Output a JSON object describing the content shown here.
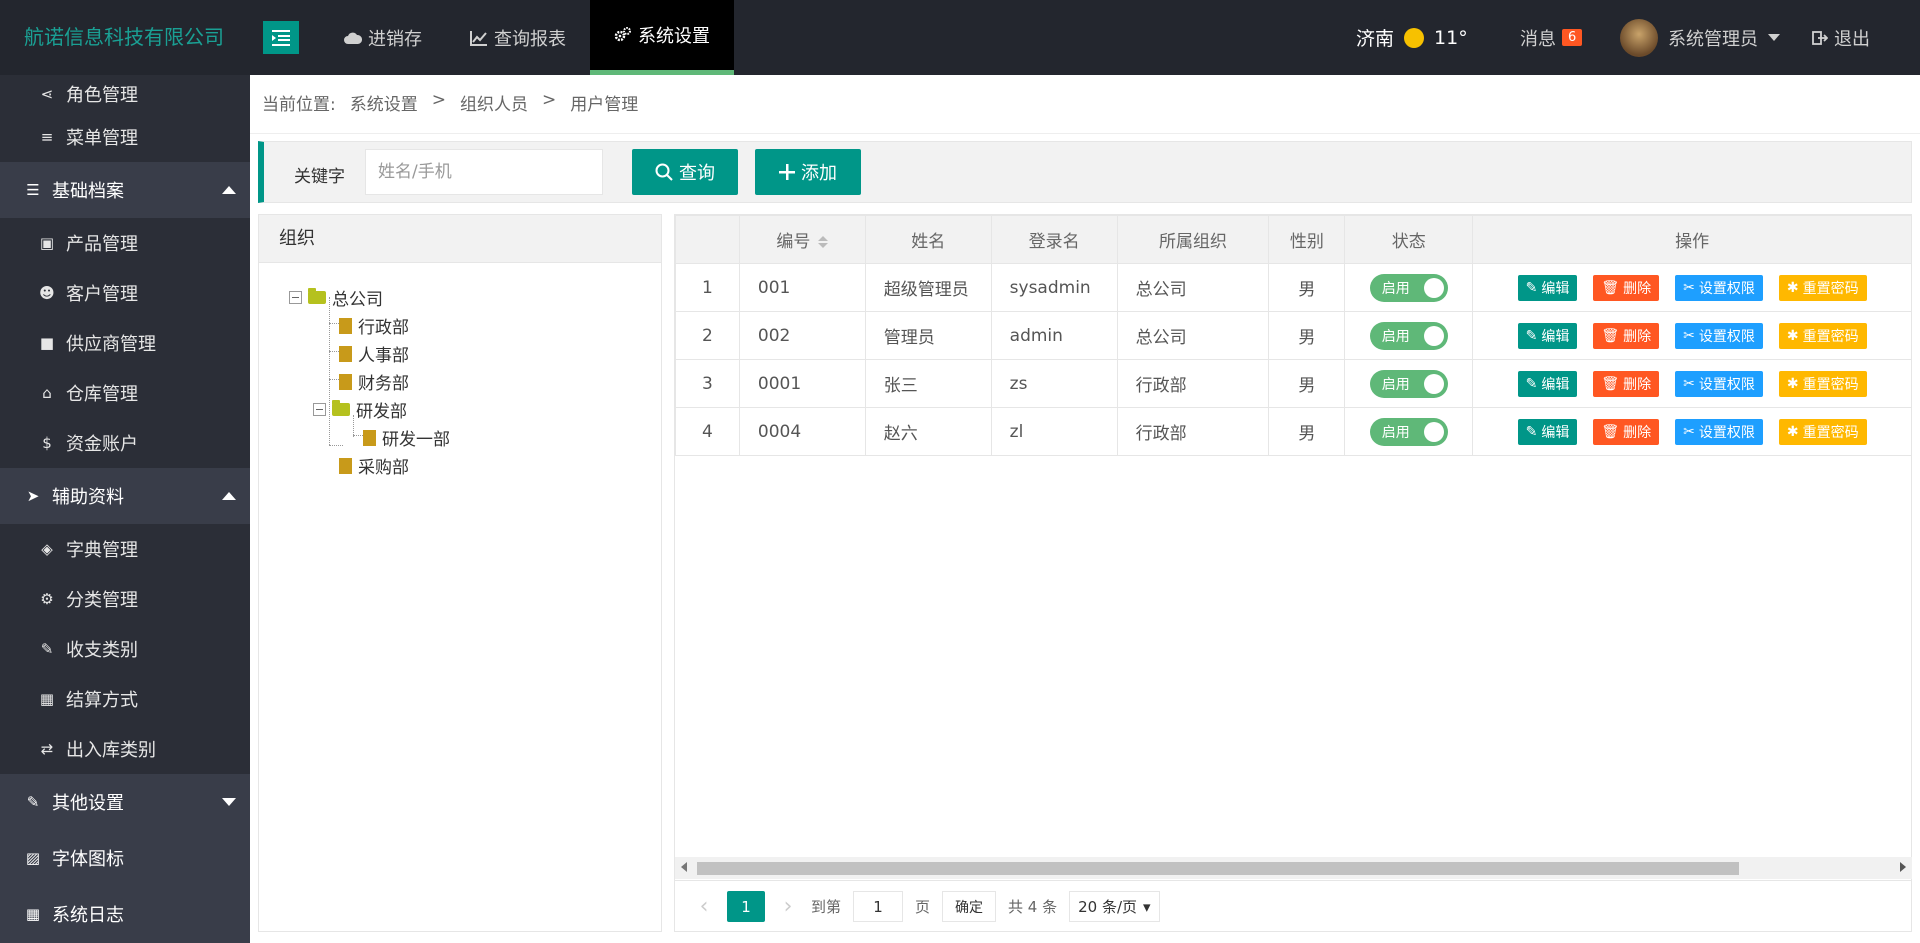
{
  "topbar": {
    "brand": "航诺信息科技有限公司",
    "nav": [
      {
        "label": "进销存",
        "icon": "cloud-icon"
      },
      {
        "label": "查询报表",
        "icon": "line-chart-icon"
      },
      {
        "label": "系统设置",
        "icon": "gears-icon"
      }
    ],
    "weather_city": "济南",
    "weather_temp": "11°",
    "messages_label": "消息",
    "messages_count": "6",
    "user_name": "系统管理员",
    "logout_label": "退出"
  },
  "sidebar": {
    "items": [
      {
        "label": "角色管理",
        "icon": "share-icon",
        "type": "sub"
      },
      {
        "label": "菜单管理",
        "icon": "bars-icon",
        "type": "sub"
      },
      {
        "label": "基础档案",
        "icon": "list-icon",
        "type": "head",
        "expanded": true
      },
      {
        "label": "产品管理",
        "icon": "shopping-bag-icon",
        "type": "sub"
      },
      {
        "label": "客户管理",
        "icon": "user-plus-icon",
        "type": "sub"
      },
      {
        "label": "供应商管理",
        "icon": "truck-icon",
        "type": "sub"
      },
      {
        "label": "仓库管理",
        "icon": "home-icon",
        "type": "sub"
      },
      {
        "label": "资金账户",
        "icon": "dollar-circle-icon",
        "type": "sub"
      },
      {
        "label": "辅助资料",
        "icon": "paper-plane-icon",
        "type": "head",
        "expanded": true
      },
      {
        "label": "字典管理",
        "icon": "layers-icon",
        "type": "sub"
      },
      {
        "label": "分类管理",
        "icon": "gears-icon",
        "type": "sub"
      },
      {
        "label": "收支类别",
        "icon": "edit-square-icon",
        "type": "sub"
      },
      {
        "label": "结算方式",
        "icon": "calculator-icon",
        "type": "sub"
      },
      {
        "label": "出入库类别",
        "icon": "exchange-icon",
        "type": "sub"
      },
      {
        "label": "其他设置",
        "icon": "edit-icon",
        "type": "head",
        "expanded": false
      },
      {
        "label": "字体图标",
        "icon": "image-icon",
        "type": "head"
      },
      {
        "label": "系统日志",
        "icon": "table-icon",
        "type": "head"
      }
    ]
  },
  "breadcrumb": {
    "prefix": "当前位置:",
    "items": [
      "系统设置",
      "组织人员",
      "用户管理"
    ],
    "sep": ">"
  },
  "search": {
    "label": "关键字",
    "placeholder": "姓名/手机",
    "query_label": "查询",
    "add_label": "添加"
  },
  "org": {
    "title": "组织",
    "tree": {
      "root": "总公司",
      "children": [
        "行政部",
        "人事部",
        "财务部",
        "研发部",
        "采购部"
      ],
      "rd_children": [
        "研发一部"
      ]
    }
  },
  "table": {
    "columns": [
      "",
      "编号",
      "姓名",
      "登录名",
      "所属组织",
      "性别",
      "状态",
      "操作"
    ],
    "rows": [
      {
        "idx": "1",
        "code": "001",
        "name": "超级管理员",
        "login": "sysadmin",
        "org": "总公司",
        "gender": "男",
        "status": "启用"
      },
      {
        "idx": "2",
        "code": "002",
        "name": "管理员",
        "login": "admin",
        "org": "总公司",
        "gender": "男",
        "status": "启用"
      },
      {
        "idx": "3",
        "code": "0001",
        "name": "张三",
        "login": "zs",
        "org": "行政部",
        "gender": "男",
        "status": "启用"
      },
      {
        "idx": "4",
        "code": "0004",
        "name": "赵六",
        "login": "zl",
        "org": "行政部",
        "gender": "男",
        "status": "启用"
      }
    ],
    "actions": {
      "edit": "编辑",
      "delete": "删除",
      "perm": "设置权限",
      "reset": "重置密码"
    }
  },
  "pager": {
    "current": "1",
    "goto_label": "到第",
    "page_input": "1",
    "page_label": "页",
    "confirm": "确定",
    "total": "共 4 条",
    "page_size": "20 条/页"
  },
  "colors": {
    "accent": "#009688",
    "brand_text": "#1aa094",
    "danger": "#ff5722",
    "info": "#1e9fff",
    "warn": "#ffb800",
    "sidebar_bg": "#393d49",
    "topbar_bg": "#23262e"
  }
}
